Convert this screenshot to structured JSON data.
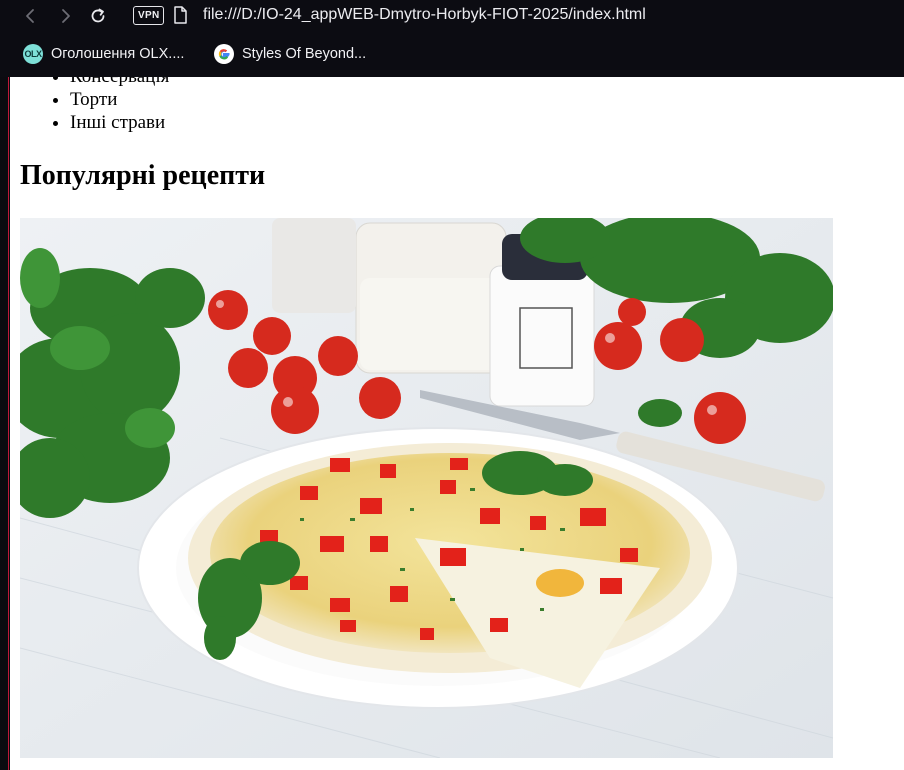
{
  "browser": {
    "vpn_label": "VPN",
    "address": "file:///D:/IO-24_appWEB-Dmytro-Horbyk-FIOT-2025/index.html",
    "bookmarks": [
      {
        "label": "Оголошення OLX....",
        "icon": "olx-icon",
        "icon_text": "OLX"
      },
      {
        "label": "Styles Of Beyond...",
        "icon": "google-icon"
      }
    ],
    "icons": [
      "back-arrow-icon",
      "forward-arrow-icon",
      "reload-icon",
      "page-icon"
    ]
  },
  "page": {
    "categories": [
      "Консервація",
      "Торти",
      "Інші страви"
    ],
    "section_title": "Популярні рецепти",
    "photo": {
      "subject": "omelette-dish-photo",
      "colors": {
        "plate": "#ffffff",
        "tomato": "#d62a1e",
        "greens": "#2f7a2a",
        "cheese": "#f0dc8a"
      }
    }
  }
}
